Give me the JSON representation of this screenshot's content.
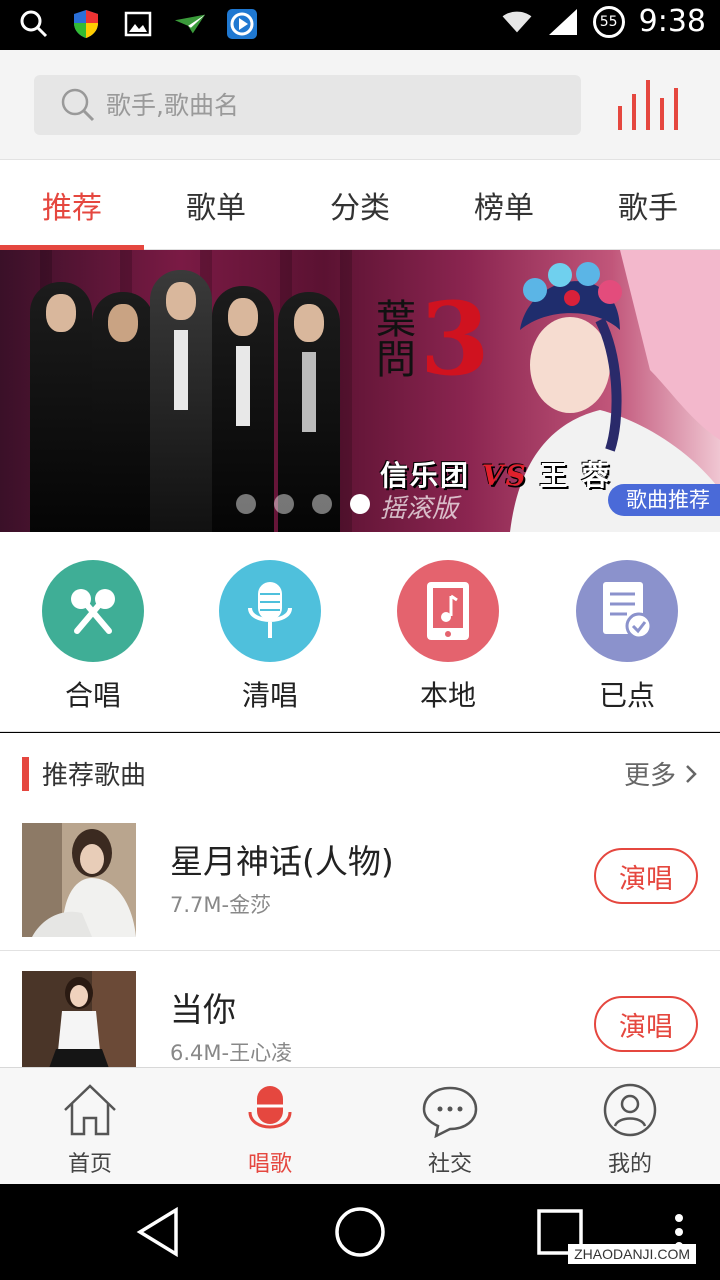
{
  "status_bar": {
    "time": "9:38",
    "battery_level": "55"
  },
  "search": {
    "placeholder": "歌手,歌曲名"
  },
  "tabs": [
    {
      "label": "推荐",
      "active": true
    },
    {
      "label": "歌单",
      "active": false
    },
    {
      "label": "分类",
      "active": false
    },
    {
      "label": "榜单",
      "active": false
    },
    {
      "label": "歌手",
      "active": false
    }
  ],
  "banner": {
    "title_chars": "葉問",
    "title_number": "3",
    "caption_left": "信乐团",
    "caption_vs": "VS",
    "caption_right": "王 蓉",
    "subcaption": "摇滚版",
    "tag": "歌曲推荐",
    "page_count": 4,
    "active_page": 4
  },
  "features": [
    {
      "label": "合唱",
      "color": "#3fae96",
      "icon": "karaoke-mics-icon"
    },
    {
      "label": "清唱",
      "color": "#4fc0dc",
      "icon": "microphone-icon"
    },
    {
      "label": "本地",
      "color": "#e4636e",
      "icon": "music-file-icon"
    },
    {
      "label": "已点",
      "color": "#8b92cc",
      "icon": "checklist-icon"
    }
  ],
  "recommended": {
    "title": "推荐歌曲",
    "more": "更多",
    "songs": [
      {
        "name": "星月神话(人物)",
        "meta": "7.7M-金莎",
        "button": "演唱"
      },
      {
        "name": "当你",
        "meta": "6.4M-王心凌",
        "button": "演唱"
      }
    ]
  },
  "bottom_nav": [
    {
      "label": "首页",
      "icon": "home-icon",
      "active": false
    },
    {
      "label": "唱歌",
      "icon": "mic-icon",
      "active": true
    },
    {
      "label": "社交",
      "icon": "chat-icon",
      "active": false
    },
    {
      "label": "我的",
      "icon": "profile-icon",
      "active": false
    }
  ],
  "watermark": "ZHAODANJI.COM",
  "colors": {
    "accent": "#e5473f",
    "banner_tag": "#4a6ad8"
  }
}
